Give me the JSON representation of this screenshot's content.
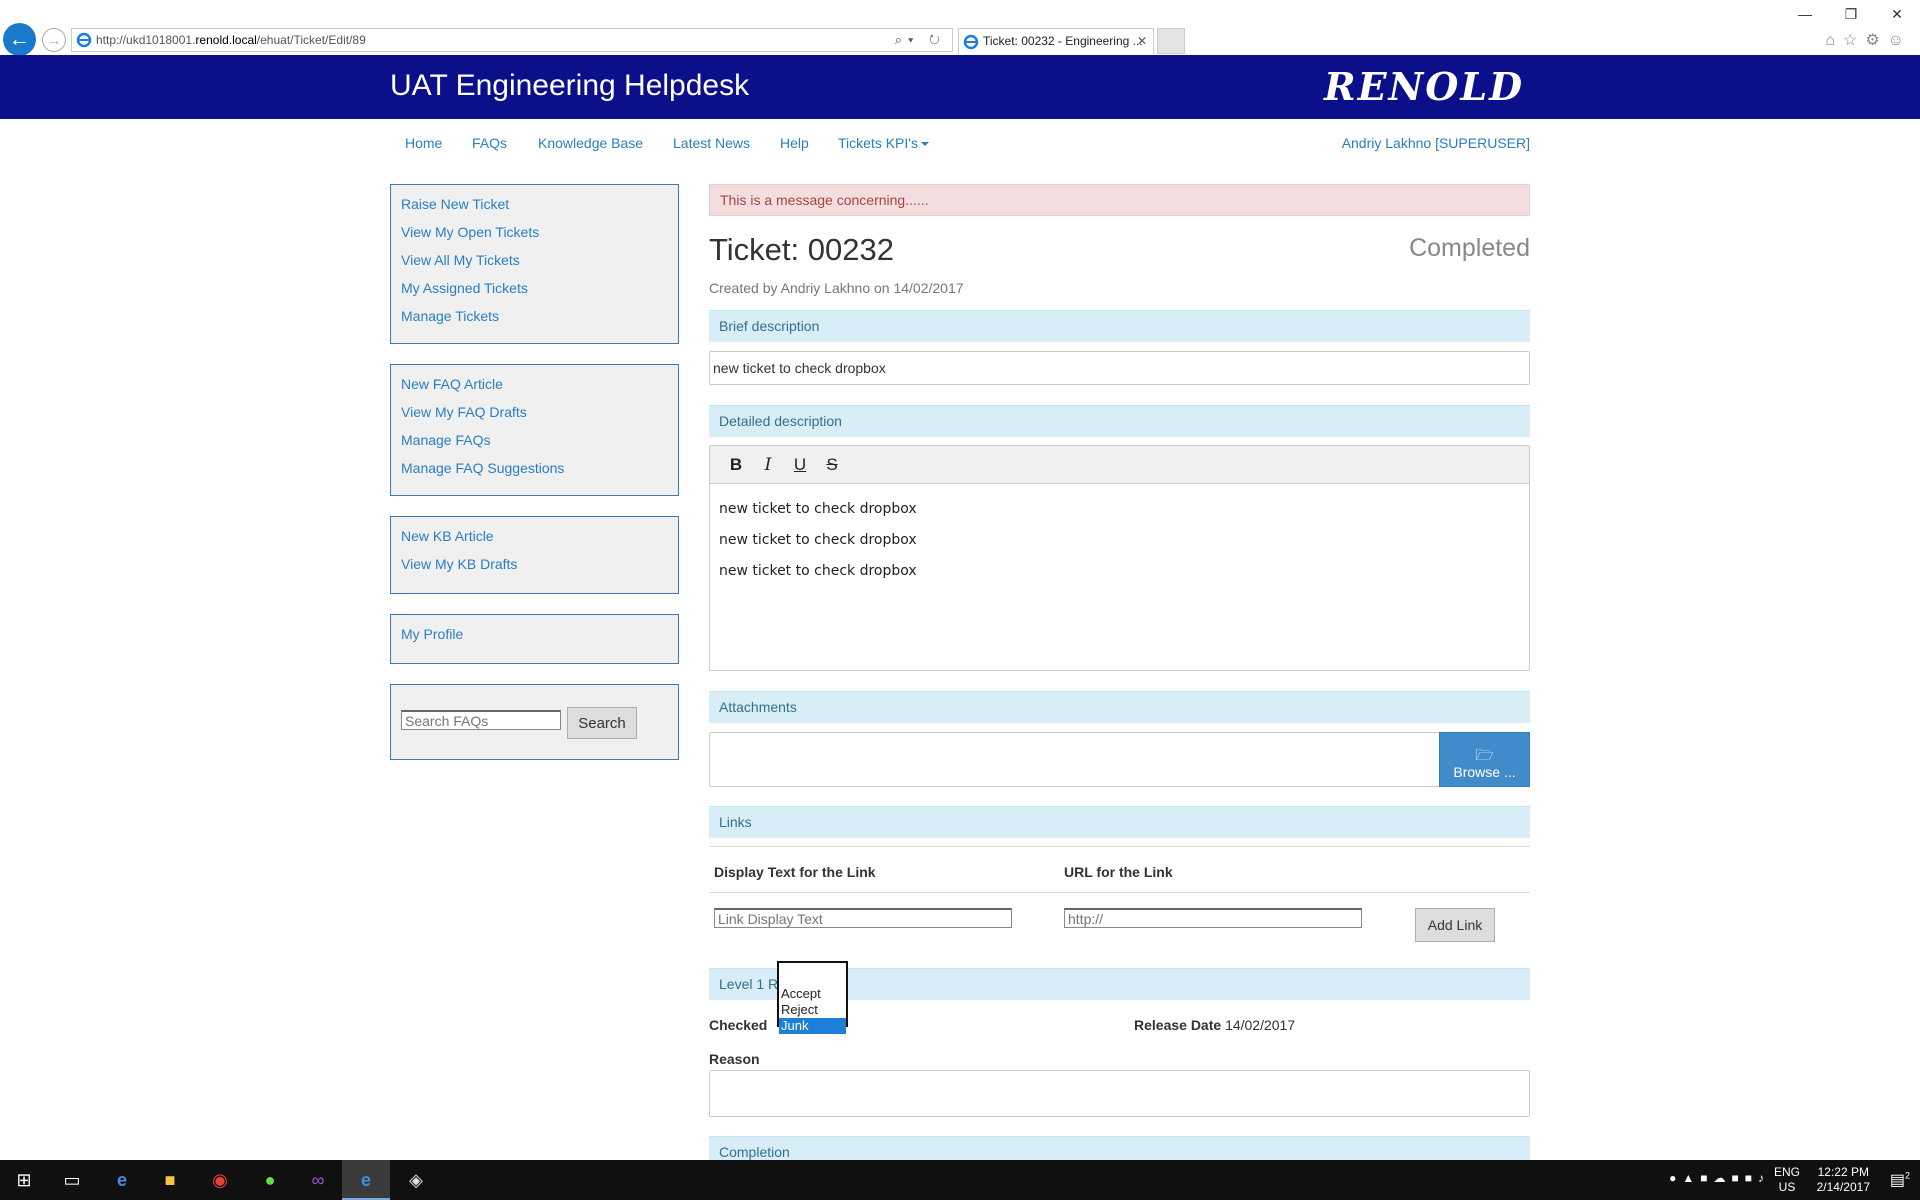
{
  "browser": {
    "url_prefix": "http://ukd1018001.",
    "url_host": "renold.local",
    "url_path": "/ehuat/Ticket/Edit/89",
    "tab_title": "Ticket: 00232 - Engineering ...",
    "tab_close": "✕",
    "addr_tools": "⌕▾ ↻",
    "win_min": "—",
    "win_restore": "❐",
    "win_close": "✕",
    "chrome_icons": "⌂☆⚙☺"
  },
  "header": {
    "site_title": "UAT Engineering Helpdesk",
    "logo_text": "RENOLD"
  },
  "topnav": {
    "items": [
      "Home",
      "FAQs",
      "Knowledge Base",
      "Latest News",
      "Help",
      "Tickets KPI's"
    ],
    "user": "Andriy Lakhno [SUPERUSER]"
  },
  "sidebar": {
    "tickets": [
      "Raise New Ticket",
      "View My Open Tickets",
      "View All My Tickets",
      "My Assigned Tickets",
      "Manage Tickets"
    ],
    "faqs": [
      "New FAQ Article",
      "View My FAQ Drafts",
      "Manage FAQs",
      "Manage FAQ Suggestions"
    ],
    "kb": [
      "New KB Article",
      "View My KB Drafts"
    ],
    "profile": [
      "My Profile"
    ],
    "search_placeholder": "Search FAQs",
    "search_button": "Search"
  },
  "main": {
    "alert": "This is a message concerning......",
    "ticket_title": "Ticket: 00232",
    "status": "Completed",
    "created": "Created by Andriy Lakhno on 14/02/2017",
    "brief_label": "Brief description",
    "brief_value": "new ticket to check dropbox",
    "detailed_label": "Detailed description",
    "toolbar": {
      "bold": "B",
      "italic": "I",
      "underline": "U",
      "strike": "S"
    },
    "detailed_lines": [
      "new ticket to check dropbox",
      "new ticket to check dropbox",
      "new ticket to check dropbox"
    ],
    "attachments_label": "Attachments",
    "browse_button": "Browse ...",
    "links_label": "Links",
    "col_display": "Display Text for the Link",
    "col_url": "URL for the Link",
    "display_placeholder": "Link Display Text",
    "url_placeholder": "http://",
    "add_link_button": "Add Link",
    "level1_label": "Level 1 R",
    "checked_label": "Checked",
    "release_label": "Release Date",
    "release_value": "14/02/2017",
    "reason_label": "Reason",
    "completion_label": "Completion",
    "dropdown_options": [
      "Accept",
      "Reject",
      "Junk"
    ],
    "dropdown_selected": "Junk"
  },
  "taskbar": {
    "lang": "ENG",
    "region": "US",
    "time": "12:22 PM",
    "date": "2/14/2017",
    "notification_count": "2"
  },
  "colors": {
    "header_bg": "#0b0f8a",
    "link": "#2a7ec2",
    "section_bg": "#d9edf7",
    "alert_bg": "#f2dede",
    "primary": "#428bca"
  }
}
